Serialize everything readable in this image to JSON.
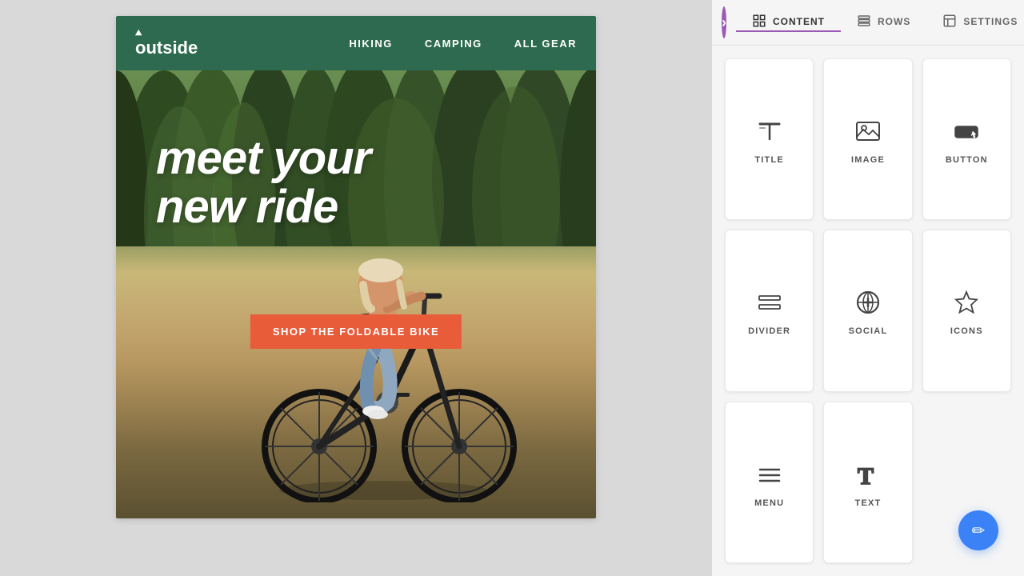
{
  "brand": {
    "name": "outside",
    "logo_symbol": "⛰"
  },
  "email": {
    "nav": {
      "items": [
        {
          "label": "HIKING"
        },
        {
          "label": "CAMPING"
        },
        {
          "label": "ALL GEAR"
        }
      ]
    },
    "hero": {
      "headline_line1": "meet your",
      "headline_line2": "new ride",
      "cta_label": "SHOP THE FOLDABLE BIKE"
    }
  },
  "panel": {
    "tabs": [
      {
        "label": "CONTENT",
        "id": "content",
        "active": true
      },
      {
        "label": "ROWS",
        "id": "rows",
        "active": false
      },
      {
        "label": "SETTINGS",
        "id": "settings",
        "active": false
      }
    ],
    "content_items": [
      {
        "id": "title",
        "label": "TITLE",
        "icon": "title"
      },
      {
        "id": "image",
        "label": "IMAGE",
        "icon": "image"
      },
      {
        "id": "button",
        "label": "BUTTON",
        "icon": "button"
      },
      {
        "id": "divider",
        "label": "DIVIDER",
        "icon": "divider"
      },
      {
        "id": "social",
        "label": "SOCIAL",
        "icon": "social"
      },
      {
        "id": "icons",
        "label": "ICONS",
        "icon": "icons"
      },
      {
        "id": "menu",
        "label": "MENU",
        "icon": "menu"
      },
      {
        "id": "text",
        "label": "TEXT",
        "icon": "text"
      }
    ]
  },
  "fab": {
    "icon": "✏"
  }
}
